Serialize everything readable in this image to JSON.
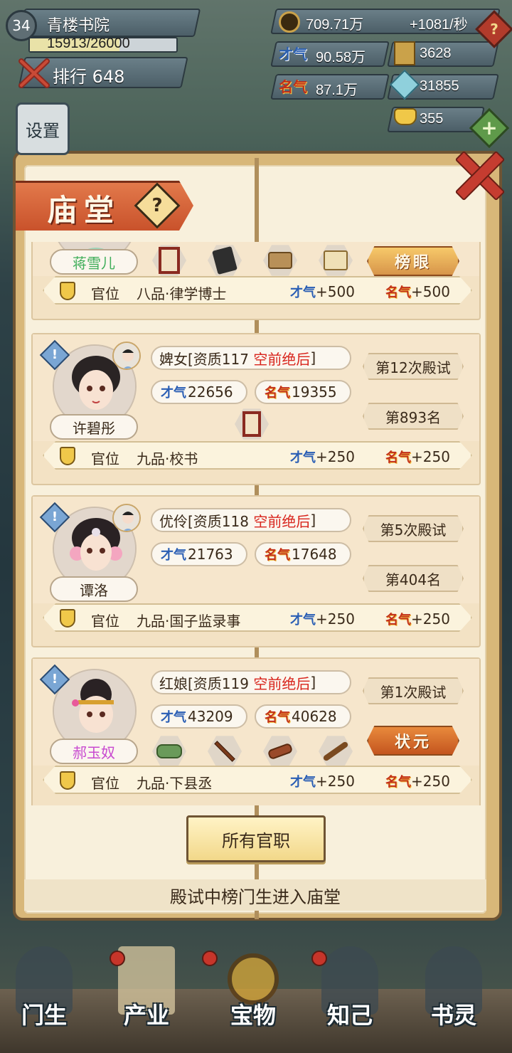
{
  "hud": {
    "level": "34",
    "player_name": "青楼书院",
    "exp": "15913/26000",
    "exp_fraction": 0.612,
    "rank_label": "排行",
    "rank_value": "648",
    "settings_label": "设置",
    "silver": "709.71万",
    "silver_rate": "+1081/秒",
    "caiqi_value": "90.58万",
    "mingqi_value": "87.1万",
    "item_a_value": "3628",
    "gem_value": "31855",
    "gold_value": "355",
    "help_glyph": "?",
    "plus_glyph": "+"
  },
  "panel": {
    "title": "庙堂",
    "help_glyph": "?",
    "all_offices_button": "所有官职",
    "footer_note": "殿试中榜门生进入庙堂"
  },
  "glyphs": {
    "cai": "才气",
    "ming": "名气",
    "office_label": "官位",
    "alert": "!"
  },
  "cards": [
    {
      "name": "蒋雪儿",
      "name_color": "#3fae5a",
      "rank": "八品·律学博士",
      "cai_bonus": "+500",
      "ming_bonus": "+500",
      "title_badge": "榜眼",
      "items": [
        "frame-icon",
        "book-icon",
        "scroll-bundle-icon",
        "chest-icon"
      ]
    },
    {
      "name": "许碧彤",
      "name_color": "#3a2a1a",
      "role": "婢女[资质117",
      "quality": "空前绝后",
      "quality_suffix": "]",
      "cai": "22656",
      "ming": "19355",
      "exam_count": "第12次殿试",
      "placement": "第893名",
      "rank": "九品·校书",
      "cai_bonus": "+250",
      "ming_bonus": "+250",
      "items": [
        "frame-icon"
      ]
    },
    {
      "name": "谭洛",
      "name_color": "#3a2a1a",
      "role": "优伶[资质118",
      "quality": "空前绝后",
      "quality_suffix": "]",
      "cai": "21763",
      "ming": "17648",
      "exam_count": "第5次殿试",
      "placement": "第404名",
      "rank": "九品·国子监录事",
      "cai_bonus": "+250",
      "ming_bonus": "+250"
    },
    {
      "name": "郝玉奴",
      "name_color": "#c84ad0",
      "role": "红娘[资质119",
      "quality": "空前绝后",
      "quality_suffix": "]",
      "cai": "43209",
      "ming": "40628",
      "exam_count": "第1次殿试",
      "title_badge": "状元",
      "rank": "九品·下县丞",
      "cai_bonus": "+250",
      "ming_bonus": "+250",
      "items": [
        "ink-stone-icon",
        "crossed-swords-icon",
        "scrolls-icon",
        "flute-icon"
      ]
    }
  ],
  "nav": [
    {
      "label": "门生",
      "icon": "student-icon"
    },
    {
      "label": "产业",
      "icon": "property-icon"
    },
    {
      "label": "宝物",
      "icon": "treasure-icon"
    },
    {
      "label": "知己",
      "icon": "confidante-icon"
    },
    {
      "label": "书灵",
      "icon": "book-spirit-icon"
    }
  ]
}
